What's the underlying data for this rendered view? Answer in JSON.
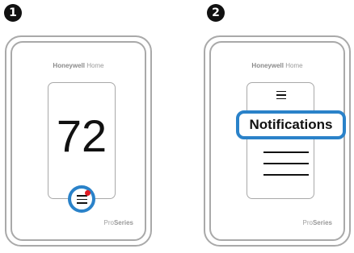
{
  "steps": [
    {
      "number": "1",
      "brand_bold": "Honeywell",
      "brand_light": " Home",
      "temperature": "72",
      "series_light": "Pro",
      "series_bold": "Series"
    },
    {
      "number": "2",
      "brand_bold": "Honeywell",
      "brand_light": " Home",
      "notification_label": "Notifications",
      "series_light": "Pro",
      "series_bold": "Series"
    }
  ],
  "colors": {
    "highlight": "#2a82c9",
    "alert_dot": "#e11b22",
    "frame": "#a9a9a9"
  }
}
